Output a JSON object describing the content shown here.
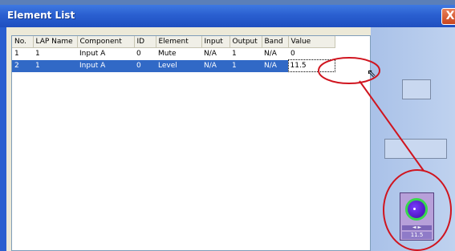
{
  "window": {
    "title": "Element List",
    "close_glyph": "X"
  },
  "table": {
    "headers": [
      "No.",
      "LAP Name",
      "Component",
      "ID",
      "Element",
      "Input",
      "Output",
      "Band",
      "Value"
    ],
    "rows": [
      {
        "no": "1",
        "lap": "1",
        "component": "Input A",
        "id": "0",
        "element": "Mute",
        "input": "N/A",
        "output": "1",
        "band": "N/A",
        "value": "0"
      },
      {
        "no": "2",
        "lap": "1",
        "component": "Input A",
        "id": "0",
        "element": "Level",
        "input": "N/A",
        "output": "1",
        "band": "N/A",
        "value": "11.5"
      }
    ],
    "selected_row": 2
  },
  "knob": {
    "value": "11.5",
    "arrows": "◄ ►",
    "icon": "knob-icon"
  },
  "colors": {
    "title_bar": "#2a5fd0",
    "selection": "#3169c6",
    "annotation": "#d0141e",
    "knob_ring": "#37d84c"
  }
}
